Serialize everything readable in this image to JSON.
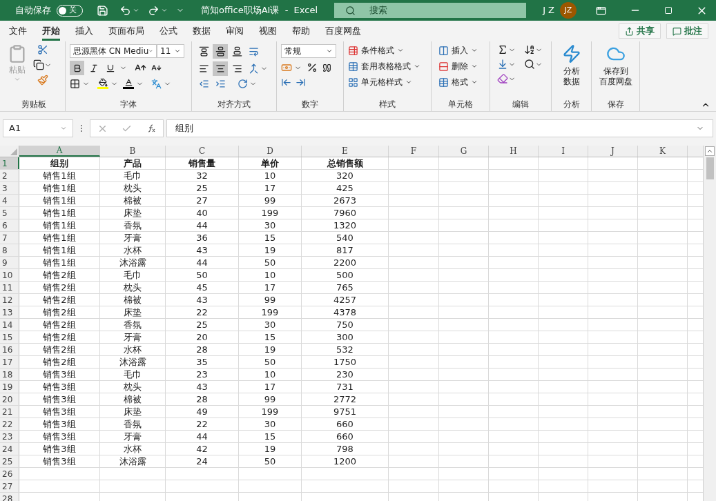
{
  "title_bar": {
    "autosave_label": "自动保存",
    "autosave_toggle": {
      "label": "关",
      "on": false
    },
    "title": "简知office职场AI课  -  Excel",
    "search_placeholder": "搜索",
    "user_initials": "J Z",
    "avatar": "JZ"
  },
  "menu_tabs": [
    {
      "label": "文件",
      "selected": false
    },
    {
      "label": "开始",
      "selected": true
    },
    {
      "label": "插入",
      "selected": false
    },
    {
      "label": "页面布局",
      "selected": false
    },
    {
      "label": "公式",
      "selected": false
    },
    {
      "label": "数据",
      "selected": false
    },
    {
      "label": "审阅",
      "selected": false
    },
    {
      "label": "视图",
      "selected": false
    },
    {
      "label": "帮助",
      "selected": false
    },
    {
      "label": "百度网盘",
      "selected": false
    }
  ],
  "share_button": "共享",
  "comments_button": "批注",
  "ribbon": {
    "clipboard": {
      "paste": "粘贴",
      "label": "剪贴板"
    },
    "font": {
      "font_name": "思源黑体 CN Mediu",
      "font_size": "11",
      "bold": true,
      "italic": false,
      "underline": false,
      "label": "字体"
    },
    "alignment": {
      "vertical_middle": true,
      "horizontal_center": true,
      "label": "对齐方式"
    },
    "number": {
      "format": "常规",
      "label": "数字"
    },
    "styles": {
      "items": [
        "条件格式",
        "套用表格格式",
        "单元格样式"
      ],
      "label": "样式"
    },
    "cells": {
      "items": [
        "插入",
        "删除",
        "格式"
      ],
      "label": "单元格"
    },
    "editing": {
      "label": "编辑"
    },
    "analysis": {
      "button": [
        "分析",
        "数据"
      ],
      "label": "分析"
    },
    "save": {
      "button": [
        "保存到",
        "百度网盘"
      ],
      "label": "保存"
    }
  },
  "formula_bar": {
    "name_box": "A1",
    "formula": "组别"
  },
  "sheet": {
    "columns": [
      {
        "label": "A",
        "selected": true
      },
      {
        "label": "B",
        "selected": false
      },
      {
        "label": "C",
        "selected": false
      },
      {
        "label": "D",
        "selected": false
      },
      {
        "label": "E",
        "selected": false
      },
      {
        "label": "F",
        "selected": false
      },
      {
        "label": "G",
        "selected": false
      },
      {
        "label": "H",
        "selected": false
      },
      {
        "label": "I",
        "selected": false
      },
      {
        "label": "J",
        "selected": false
      },
      {
        "label": "K",
        "selected": false
      }
    ],
    "rows": [
      {
        "number": "1",
        "selected": true,
        "kind": "header",
        "cells": [
          "组别",
          "产品",
          "销售量",
          "单价",
          "总销售额"
        ]
      },
      {
        "number": "2",
        "selected": false,
        "kind": "data",
        "cells": [
          "销售1组",
          "毛巾",
          "32",
          "10",
          "320"
        ]
      },
      {
        "number": "3",
        "selected": false,
        "kind": "data",
        "cells": [
          "销售1组",
          "枕头",
          "25",
          "17",
          "425"
        ]
      },
      {
        "number": "4",
        "selected": false,
        "kind": "data",
        "cells": [
          "销售1组",
          "棉被",
          "27",
          "99",
          "2673"
        ]
      },
      {
        "number": "5",
        "selected": false,
        "kind": "data",
        "cells": [
          "销售1组",
          "床垫",
          "40",
          "199",
          "7960"
        ]
      },
      {
        "number": "6",
        "selected": false,
        "kind": "data",
        "cells": [
          "销售1组",
          "香氛",
          "44",
          "30",
          "1320"
        ]
      },
      {
        "number": "7",
        "selected": false,
        "kind": "data",
        "cells": [
          "销售1组",
          "牙膏",
          "36",
          "15",
          "540"
        ]
      },
      {
        "number": "8",
        "selected": false,
        "kind": "data",
        "cells": [
          "销售1组",
          "水杯",
          "43",
          "19",
          "817"
        ]
      },
      {
        "number": "9",
        "selected": false,
        "kind": "data",
        "cells": [
          "销售1组",
          "沐浴露",
          "44",
          "50",
          "2200"
        ]
      },
      {
        "number": "10",
        "selected": false,
        "kind": "data",
        "cells": [
          "销售2组",
          "毛巾",
          "50",
          "10",
          "500"
        ]
      },
      {
        "number": "11",
        "selected": false,
        "kind": "data",
        "cells": [
          "销售2组",
          "枕头",
          "45",
          "17",
          "765"
        ]
      },
      {
        "number": "12",
        "selected": false,
        "kind": "data",
        "cells": [
          "销售2组",
          "棉被",
          "43",
          "99",
          "4257"
        ]
      },
      {
        "number": "13",
        "selected": false,
        "kind": "data",
        "cells": [
          "销售2组",
          "床垫",
          "22",
          "199",
          "4378"
        ]
      },
      {
        "number": "14",
        "selected": false,
        "kind": "data",
        "cells": [
          "销售2组",
          "香氛",
          "25",
          "30",
          "750"
        ]
      },
      {
        "number": "15",
        "selected": false,
        "kind": "data",
        "cells": [
          "销售2组",
          "牙膏",
          "20",
          "15",
          "300"
        ]
      },
      {
        "number": "16",
        "selected": false,
        "kind": "data",
        "cells": [
          "销售2组",
          "水杯",
          "28",
          "19",
          "532"
        ]
      },
      {
        "number": "17",
        "selected": false,
        "kind": "data",
        "cells": [
          "销售2组",
          "沐浴露",
          "35",
          "50",
          "1750"
        ]
      },
      {
        "number": "18",
        "selected": false,
        "kind": "data",
        "cells": [
          "销售3组",
          "毛巾",
          "23",
          "10",
          "230"
        ]
      },
      {
        "number": "19",
        "selected": false,
        "kind": "data",
        "cells": [
          "销售3组",
          "枕头",
          "43",
          "17",
          "731"
        ]
      },
      {
        "number": "20",
        "selected": false,
        "kind": "data",
        "cells": [
          "销售3组",
          "棉被",
          "28",
          "99",
          "2772"
        ]
      },
      {
        "number": "21",
        "selected": false,
        "kind": "data",
        "cells": [
          "销售3组",
          "床垫",
          "49",
          "199",
          "9751"
        ]
      },
      {
        "number": "22",
        "selected": false,
        "kind": "data",
        "cells": [
          "销售3组",
          "香氛",
          "22",
          "30",
          "660"
        ]
      },
      {
        "number": "23",
        "selected": false,
        "kind": "data",
        "cells": [
          "销售3组",
          "牙膏",
          "44",
          "15",
          "660"
        ]
      },
      {
        "number": "24",
        "selected": false,
        "kind": "data",
        "cells": [
          "销售3组",
          "水杯",
          "42",
          "19",
          "798"
        ]
      },
      {
        "number": "25",
        "selected": false,
        "kind": "data",
        "cells": [
          "销售3组",
          "沐浴露",
          "24",
          "50",
          "1200"
        ]
      },
      {
        "number": "26",
        "selected": false
      },
      {
        "number": "27",
        "selected": false
      },
      {
        "number": "28",
        "selected": false
      }
    ]
  }
}
